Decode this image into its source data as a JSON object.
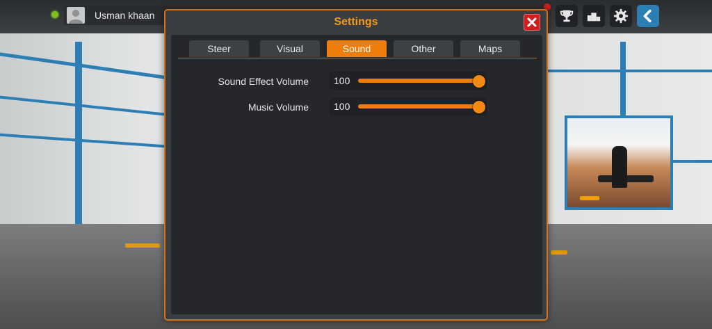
{
  "topbar": {
    "player_name": "Usman khaan",
    "icons": [
      "trophy-icon",
      "podium-icon",
      "gear-icon",
      "back-arrow-icon"
    ]
  },
  "dialog": {
    "title": "Settings",
    "tabs": [
      {
        "label": "Steer",
        "active": false
      },
      {
        "label": "Visual",
        "active": false
      },
      {
        "label": "Sound",
        "active": true
      },
      {
        "label": "Other",
        "active": false
      },
      {
        "label": "Maps",
        "active": false
      }
    ],
    "settings": [
      {
        "label": "Sound Effect Volume",
        "value": "100",
        "fill_fraction": 1.0
      },
      {
        "label": "Music Volume",
        "value": "100",
        "fill_fraction": 1.0
      }
    ]
  },
  "colors": {
    "accent": "#ee7d0b",
    "title": "#f39a1a",
    "close": "#cf1f1f",
    "panel": "#25272b"
  }
}
